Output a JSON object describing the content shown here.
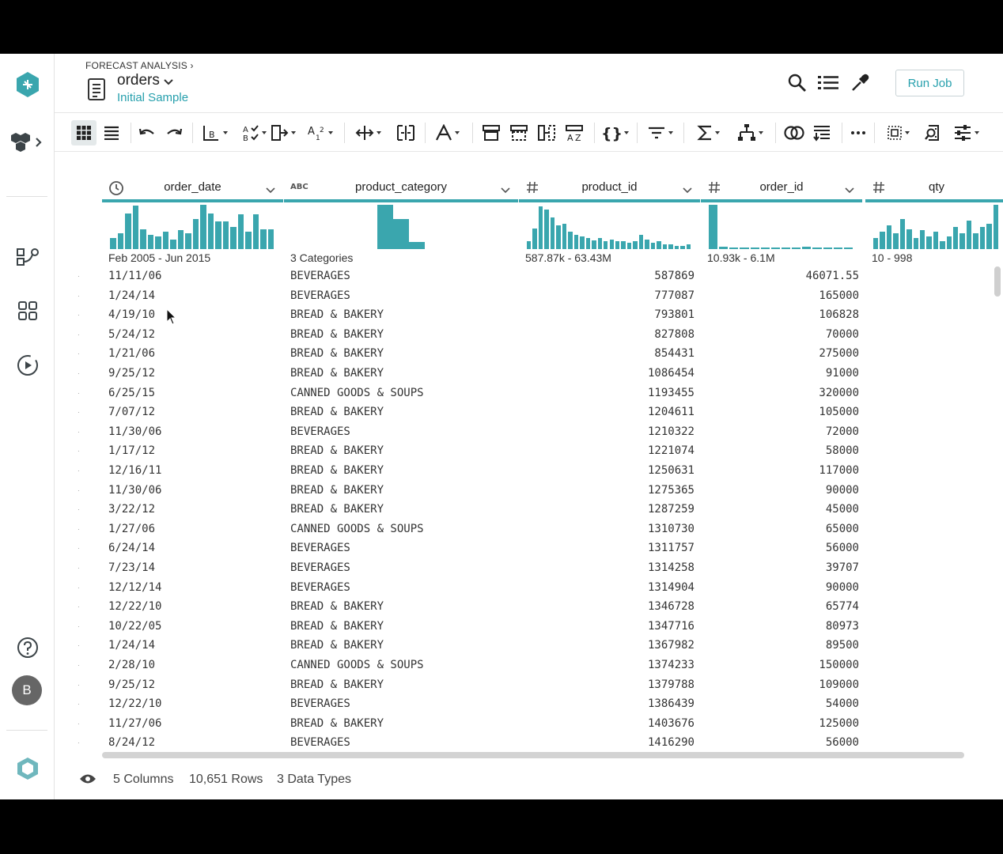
{
  "breadcrumb": "FORECAST ANALYSIS ›",
  "dataset": {
    "title": "orders",
    "sample": "Initial Sample"
  },
  "header": {
    "run_job": "Run Job"
  },
  "accent": "#27a0ad",
  "icons": {
    "rail": [
      "logo-hex-icon",
      "flows-icon",
      "pipeline-icon",
      "library-icon",
      "jobs-icon",
      "help-icon",
      "product-logo-icon"
    ],
    "toolbar": [
      "grid-view-icon",
      "list-view-icon",
      "undo-icon",
      "redo-icon",
      "format-icon",
      "validate-icon",
      "replace-icon",
      "number-format-icon",
      "move-icon",
      "split-icon",
      "text-icon",
      "row-icon",
      "column-icon",
      "merge-icon",
      "rename-icon",
      "nest-icon",
      "filter-icon",
      "aggregate-icon",
      "pivot-icon",
      "join-icon",
      "append-icon",
      "more-icon",
      "select-icon",
      "lookup-icon",
      "settings-sliders-icon"
    ]
  },
  "columns": [
    {
      "name": "order_date",
      "type_icon": "clock-icon",
      "summary": "Feb 2005 - Jun 2015",
      "hist": [
        14,
        20,
        45,
        55,
        25,
        18,
        16,
        22,
        12,
        24,
        20,
        38,
        56,
        45,
        35,
        35,
        28,
        44,
        22,
        44,
        25,
        25
      ]
    },
    {
      "name": "product_category",
      "type_icon": "abc-icon",
      "type_label": "ABC",
      "summary": "3 Categories",
      "hist": [
        56,
        38,
        9
      ]
    },
    {
      "name": "product_id",
      "type_icon": "hash-icon",
      "type_label": "#",
      "summary": "587.87k - 63.43M",
      "hist": [
        10,
        26,
        54,
        50,
        40,
        30,
        32,
        22,
        18,
        16,
        14,
        11,
        14,
        10,
        12,
        10,
        10,
        8,
        10,
        18,
        12,
        8,
        10,
        6,
        6,
        4,
        4,
        6
      ]
    },
    {
      "name": "order_id",
      "type_icon": "hash-icon",
      "type_label": "#",
      "summary": "10.93k - 6.1M",
      "hist": [
        56,
        3,
        2,
        2,
        2,
        2,
        2,
        2,
        2,
        3,
        2,
        2,
        2,
        2
      ]
    },
    {
      "name": "qty",
      "type_icon": "hash-icon",
      "type_label": "#",
      "summary": "10 - 998",
      "hist": [
        14,
        22,
        30,
        20,
        38,
        25,
        14,
        24,
        16,
        22,
        10,
        16,
        28,
        20,
        36,
        20,
        28,
        32,
        56
      ]
    }
  ],
  "rows": [
    [
      "11/11/06",
      "BEVERAGES",
      "587869",
      "46071.55"
    ],
    [
      "1/24/14",
      "BEVERAGES",
      "777087",
      "165000"
    ],
    [
      "4/19/10",
      "BREAD & BAKERY",
      "793801",
      "106828"
    ],
    [
      "5/24/12",
      "BREAD & BAKERY",
      "827808",
      "70000"
    ],
    [
      "1/21/06",
      "BREAD & BAKERY",
      "854431",
      "275000"
    ],
    [
      "9/25/12",
      "BREAD & BAKERY",
      "1086454",
      "91000"
    ],
    [
      "6/25/15",
      "CANNED GOODS & SOUPS",
      "1193455",
      "320000"
    ],
    [
      "7/07/12",
      "BREAD & BAKERY",
      "1204611",
      "105000"
    ],
    [
      "11/30/06",
      "BEVERAGES",
      "1210322",
      "72000"
    ],
    [
      "1/17/12",
      "BREAD & BAKERY",
      "1221074",
      "58000"
    ],
    [
      "12/16/11",
      "BREAD & BAKERY",
      "1250631",
      "117000"
    ],
    [
      "11/30/06",
      "BREAD & BAKERY",
      "1275365",
      "90000"
    ],
    [
      "3/22/12",
      "BREAD & BAKERY",
      "1287259",
      "45000"
    ],
    [
      "1/27/06",
      "CANNED GOODS & SOUPS",
      "1310730",
      "65000"
    ],
    [
      "6/24/14",
      "BEVERAGES",
      "1311757",
      "56000"
    ],
    [
      "7/23/14",
      "BEVERAGES",
      "1314258",
      "39707"
    ],
    [
      "12/12/14",
      "BEVERAGES",
      "1314904",
      "90000"
    ],
    [
      "12/22/10",
      "BREAD & BAKERY",
      "1346728",
      "65774"
    ],
    [
      "10/22/05",
      "BREAD & BAKERY",
      "1347716",
      "80973"
    ],
    [
      "1/24/14",
      "BREAD & BAKERY",
      "1367982",
      "89500"
    ],
    [
      "2/28/10",
      "CANNED GOODS & SOUPS",
      "1374233",
      "150000"
    ],
    [
      "9/25/12",
      "BREAD & BAKERY",
      "1379788",
      "109000"
    ],
    [
      "12/22/10",
      "BEVERAGES",
      "1386439",
      "54000"
    ],
    [
      "11/27/06",
      "BREAD & BAKERY",
      "1403676",
      "125000"
    ],
    [
      "8/24/12",
      "BEVERAGES",
      "1416290",
      "56000"
    ]
  ],
  "footer": {
    "columns": "5 Columns",
    "rows": "10,651 Rows",
    "types": "3 Data Types"
  },
  "user": {
    "avatar_initial": "B"
  }
}
